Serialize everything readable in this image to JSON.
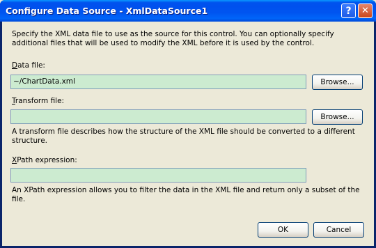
{
  "window": {
    "title": "Configure Data Source - XmlDataSource1"
  },
  "titlebar": {
    "help_glyph": "?",
    "close_glyph": "✕"
  },
  "intro": "Specify the XML data file to use as the source for this control. You can optionally specify additional files that will be used to modify the XML before it is used by the control.",
  "data_file": {
    "label_accel": "D",
    "label_rest": "ata file:",
    "value": "~/ChartData.xml",
    "browse_label": "Browse..."
  },
  "transform_file": {
    "label_accel": "T",
    "label_rest": "ransform file:",
    "value": "",
    "browse_label": "Browse...",
    "help": "A transform file describes how the structure of the XML file should be converted to a different structure."
  },
  "xpath": {
    "label_accel": "X",
    "label_rest": "Path expression:",
    "value": "",
    "help": "An XPath expression allows you to filter the data in the XML file and return only a subset of the file."
  },
  "footer": {
    "ok_label": "OK",
    "cancel_label": "Cancel"
  },
  "colors": {
    "field_bg": "#ccebd0",
    "titlebar": "#0054e3",
    "dialog_bg": "#ece9d8"
  }
}
